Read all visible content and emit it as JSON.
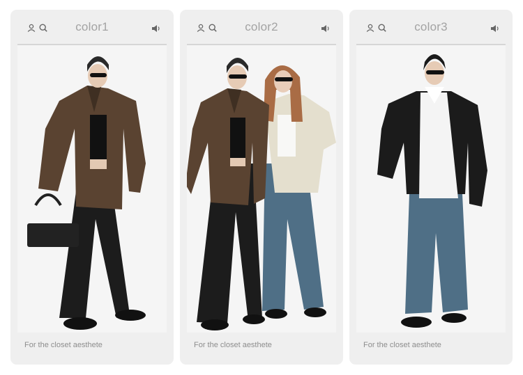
{
  "cards": [
    {
      "title": "color1",
      "caption": "For the closet aesthete",
      "photo_icon": "model-brown-leather-jacket-photo"
    },
    {
      "title": "color2",
      "caption": "For the closet aesthete",
      "photo_icon": "two-models-brown-and-cream-jackets-photo"
    },
    {
      "title": "color3",
      "caption": "For the closet aesthete",
      "photo_icon": "model-black-leather-jacket-photo"
    }
  ],
  "colors": {
    "card_bg": "#efefef",
    "title": "#a3a3a3",
    "caption": "#8d8d8d",
    "brown_jacket": "#5a4331",
    "cream_jacket": "#e4dfce",
    "black_jacket": "#1b1b1b",
    "denim": "#4f6f86"
  }
}
